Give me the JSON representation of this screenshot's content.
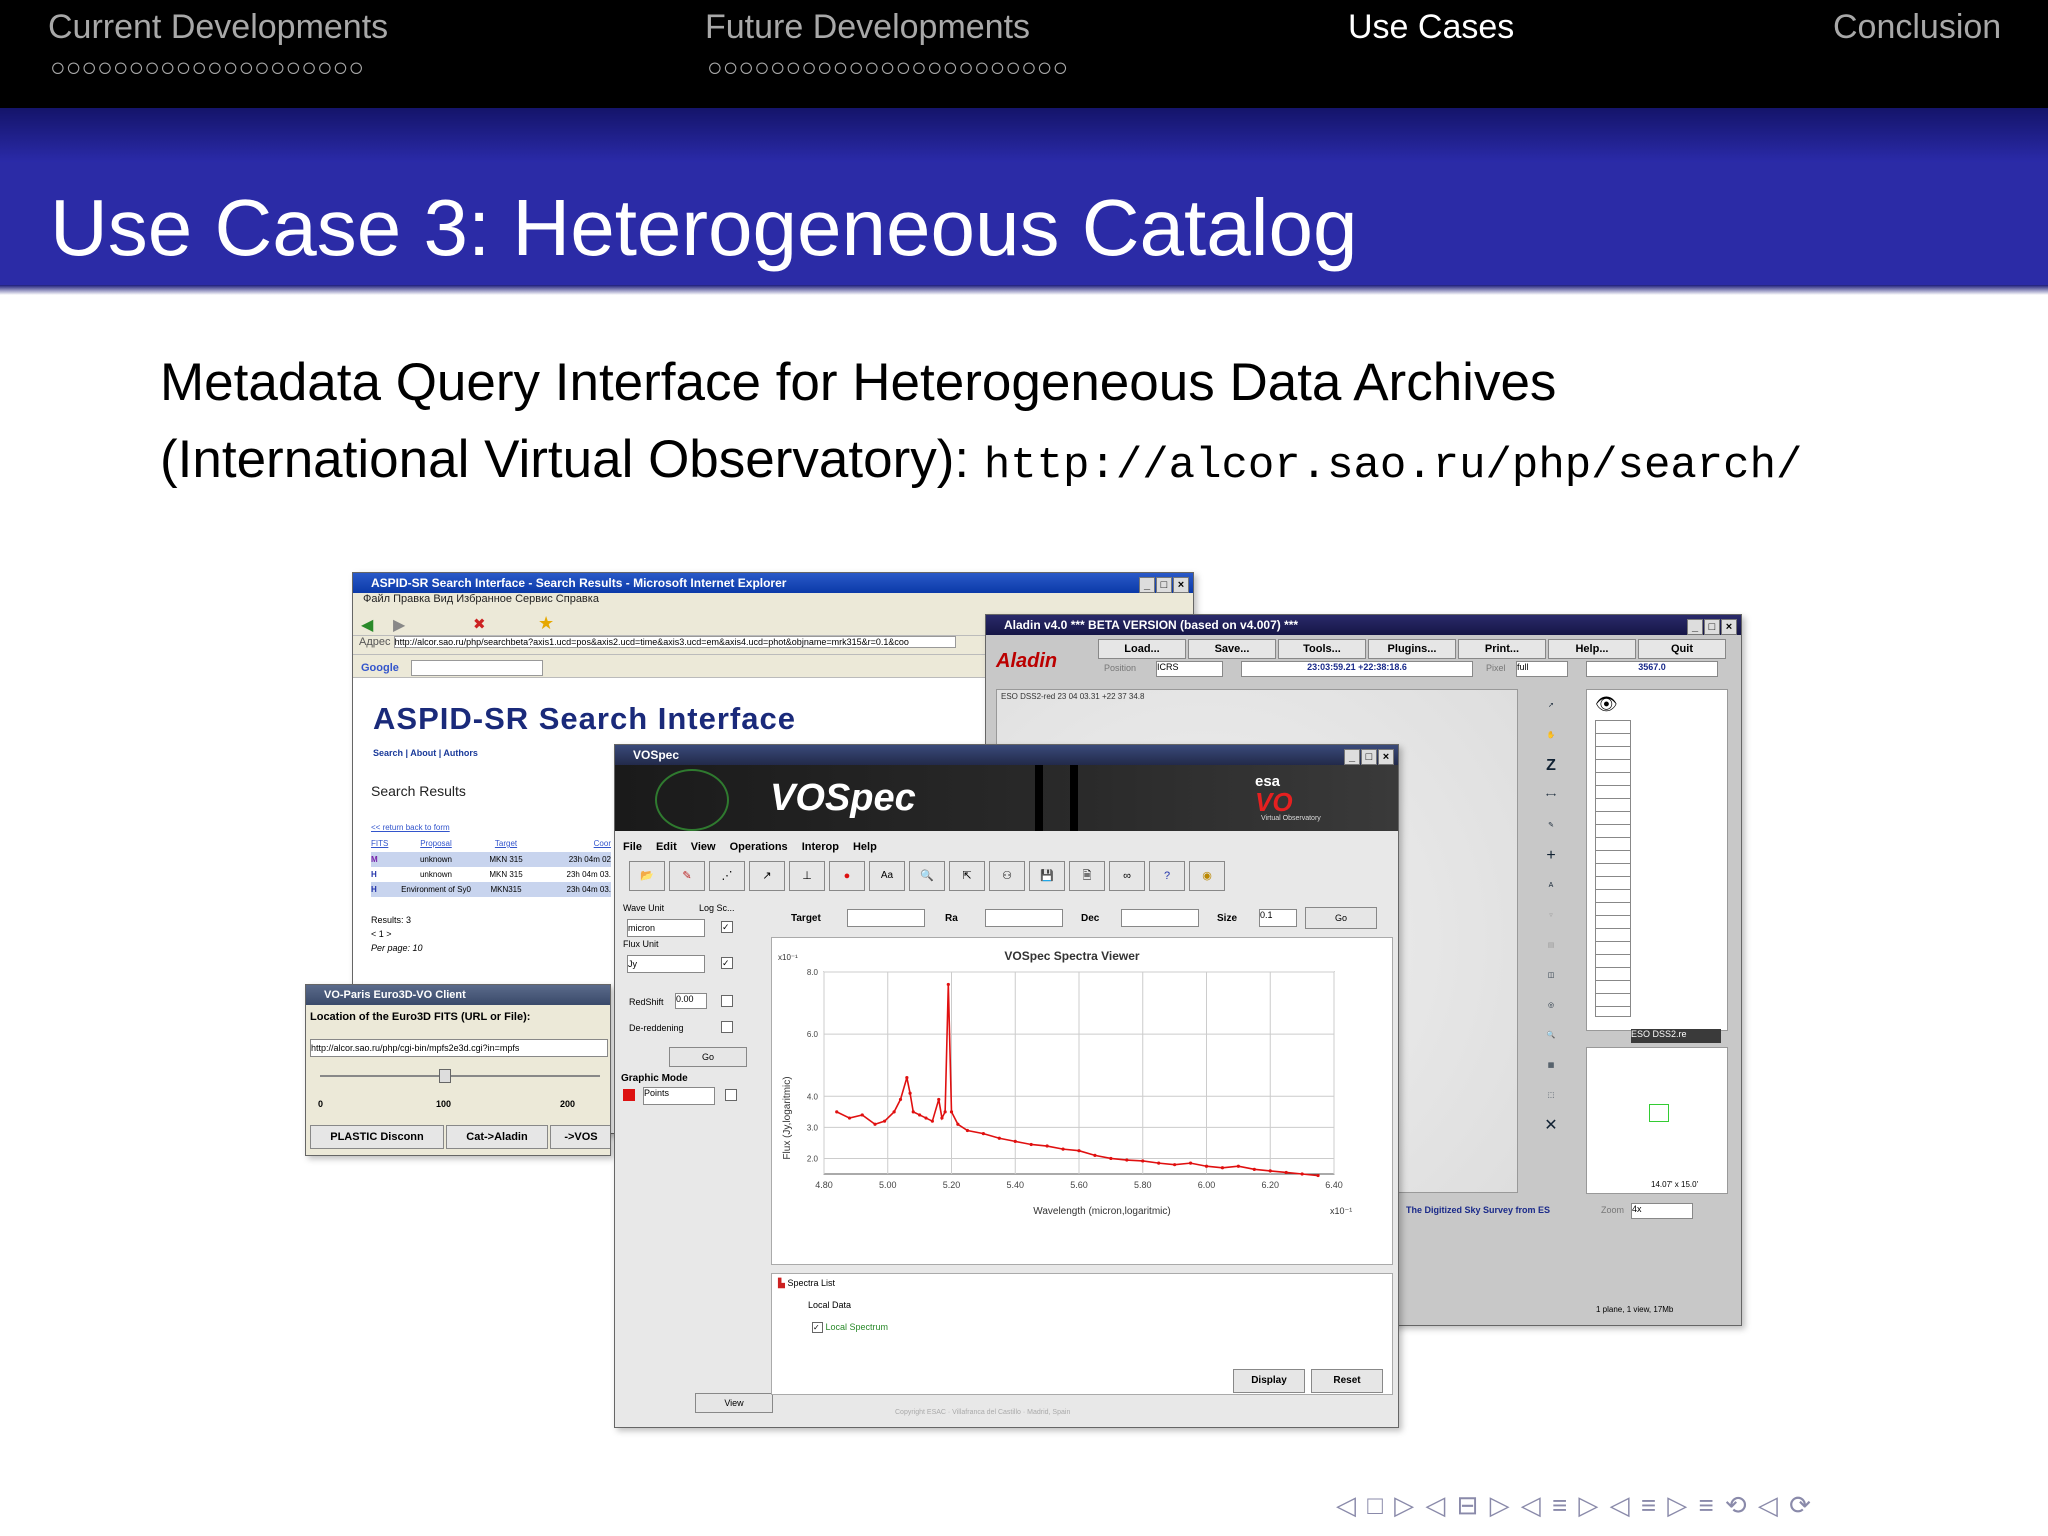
{
  "nav": {
    "sections": [
      "Current Developments",
      "Future Developments",
      "Use Cases",
      "Conclusion"
    ],
    "dots1": "○○○○○○○○○○○○○○○○○○○○",
    "dots2": "○○○○○○○○○○○○○○○○○○○○○○○"
  },
  "slide": {
    "title": "Use Case 3: Heterogeneous Catalog",
    "line1": "Metadata Query Interface for Heterogeneous Data Archives",
    "line2": "(International Virtual Observatory): ",
    "url": "http://alcor.sao.ru/php/search/"
  },
  "ie": {
    "title": "ASPID-SR Search Interface - Search Results - Microsoft Internet Explorer",
    "menu": "Файл  Правка  Вид  Избранное  Сервис  Справка",
    "address": "http://alcor.sao.ru/php/searchbeta?axis1.ucd=pos&axis2.ucd=time&axis3.ucd=em&axis4.ucd=phot&objname=mrk315&r=0.1&coo",
    "heading": "ASPID-SR Search Interface",
    "links": "Search | About | Authors",
    "results_title": "Search Results",
    "back": "<< return back to form",
    "cols": [
      "FITS",
      "Proposal",
      "Target",
      "Coor"
    ],
    "rows": [
      [
        "M",
        "unknown",
        "MKN 315",
        "23h 04m 02"
      ],
      [
        "H",
        "unknown",
        "MKN 315",
        "23h 04m 03."
      ],
      [
        "H",
        "Environment of Sy0",
        "MKN315",
        "23h 04m 03."
      ]
    ],
    "results": "Results: 3",
    "pages": "< 1 >",
    "per_page": "Per page: 10"
  },
  "euro3d": {
    "title": "VO-Paris Euro3D-VO Client",
    "label": "Location of the Euro3D FITS (URL or File):",
    "url": "http://alcor.sao.ru/php/cgi-bin/mpfs2e3d.cgi?in=mpfs",
    "ticks": [
      "0",
      "100",
      "200"
    ],
    "buttons": [
      "PLASTIC Disconn",
      "Cat->Aladin",
      "->VOS"
    ]
  },
  "aladin": {
    "title": "Aladin v4.0    *** BETA VERSION (based on v4.007) ***",
    "buttons": [
      "Load...",
      "Save...",
      "Tools...",
      "Plugins...",
      "Print...",
      "Help...",
      "Quit"
    ],
    "position_label": "Position",
    "frame": "ICRS",
    "coords": "23:03:59.21 +22:38:18.6",
    "pixel_label": "Pixel",
    "pixel_mode": "full",
    "pixel_value": "3567.0",
    "image_label": "ESO DSS2-red 23 04 03.31 +22 37 34.8",
    "tools": [
      "select",
      "pan",
      "zoom",
      "dist",
      "draw",
      "tag",
      "text",
      "filter",
      "prop",
      "xmatch",
      "rgb",
      "cont",
      "mglss",
      "pixel",
      "crop",
      "del"
    ],
    "plane": "ESO DSS2.re",
    "survey": "The Digitized Sky Survey from ES",
    "zoom_label": "Zoom",
    "zoom": "4x",
    "fov": "14.07' x 15.0'",
    "status": "1 plane, 1 view, 17Mb"
  },
  "vospec": {
    "title": "VOSpec",
    "logo": "VOSpec",
    "esa": "esa",
    "vo": "VO",
    "vo_sub": "Virtual Observatory",
    "menu": [
      "File",
      "Edit",
      "View",
      "Operations",
      "Interop",
      "Help"
    ],
    "wave_unit": "Wave Unit",
    "log_scale": "Log Sc...",
    "wave_value": "micron",
    "flux_unit": "Flux Unit",
    "flux_value": "Jy",
    "redshift": "RedShift",
    "redshift_value": "0.00",
    "dereddening": "De-reddening",
    "go_left": "Go",
    "graphic_mode": "Graphic Mode",
    "points": "Points",
    "view_btn": "View",
    "target": "Target",
    "ra": "Ra",
    "dec": "Dec",
    "size": "Size",
    "size_value": "0.1",
    "go": "Go",
    "spectra_list": "Spectra List",
    "local_data": "Local Data",
    "local_spectrum": "Local Spectrum",
    "display_btn": "Display",
    "reset_btn": "Reset",
    "copyright": "Copyright ESAC · Villafranca del Castillo · Madrid, Spain"
  },
  "chart_data": {
    "type": "line",
    "title": "VOSpec Spectra Viewer",
    "xlabel": "Wavelength (micron,logaritmic)",
    "ylabel": "Flux (Jy,logaritmic)",
    "x_exponent": "x10⁻¹",
    "y_exponent": "x10⁻¹",
    "xlim": [
      4.8,
      6.4
    ],
    "ylim": [
      1.5,
      8.0
    ],
    "x_ticks": [
      "4.80",
      "5.00",
      "5.20",
      "5.40",
      "5.60",
      "5.80",
      "6.00",
      "6.20",
      "6.40"
    ],
    "y_ticks": [
      "8.0",
      "6.0",
      "4.0",
      "3.0",
      "2.0"
    ],
    "color": "#e01010",
    "series": [
      {
        "x": [
          4.84,
          4.88,
          4.92,
          4.96,
          4.99,
          5.02,
          5.04,
          5.06,
          5.07,
          5.08,
          5.1,
          5.12,
          5.14,
          5.16,
          5.17,
          5.18,
          5.19,
          5.2,
          5.22,
          5.25,
          5.3,
          5.35,
          5.4,
          5.45,
          5.5,
          5.55,
          5.6,
          5.65,
          5.7,
          5.75,
          5.8,
          5.85,
          5.9,
          5.95,
          6.0,
          6.05,
          6.1,
          6.15,
          6.2,
          6.25,
          6.3,
          6.35
        ],
        "y": [
          3.5,
          3.3,
          3.4,
          3.1,
          3.2,
          3.5,
          3.9,
          4.6,
          4.1,
          3.5,
          3.4,
          3.3,
          3.2,
          3.9,
          3.3,
          3.5,
          7.6,
          3.5,
          3.1,
          2.9,
          2.8,
          2.65,
          2.55,
          2.45,
          2.4,
          2.3,
          2.25,
          2.1,
          2.0,
          1.95,
          1.92,
          1.85,
          1.8,
          1.85,
          1.75,
          1.7,
          1.75,
          1.65,
          1.6,
          1.55,
          1.5,
          1.45
        ]
      }
    ]
  },
  "footer_nav": "◁ □ ▷ ◁ ⊟ ▷ ◁ ≡ ▷ ◁ ≡ ▷   ≡   ⟲ ◁ ⟳"
}
